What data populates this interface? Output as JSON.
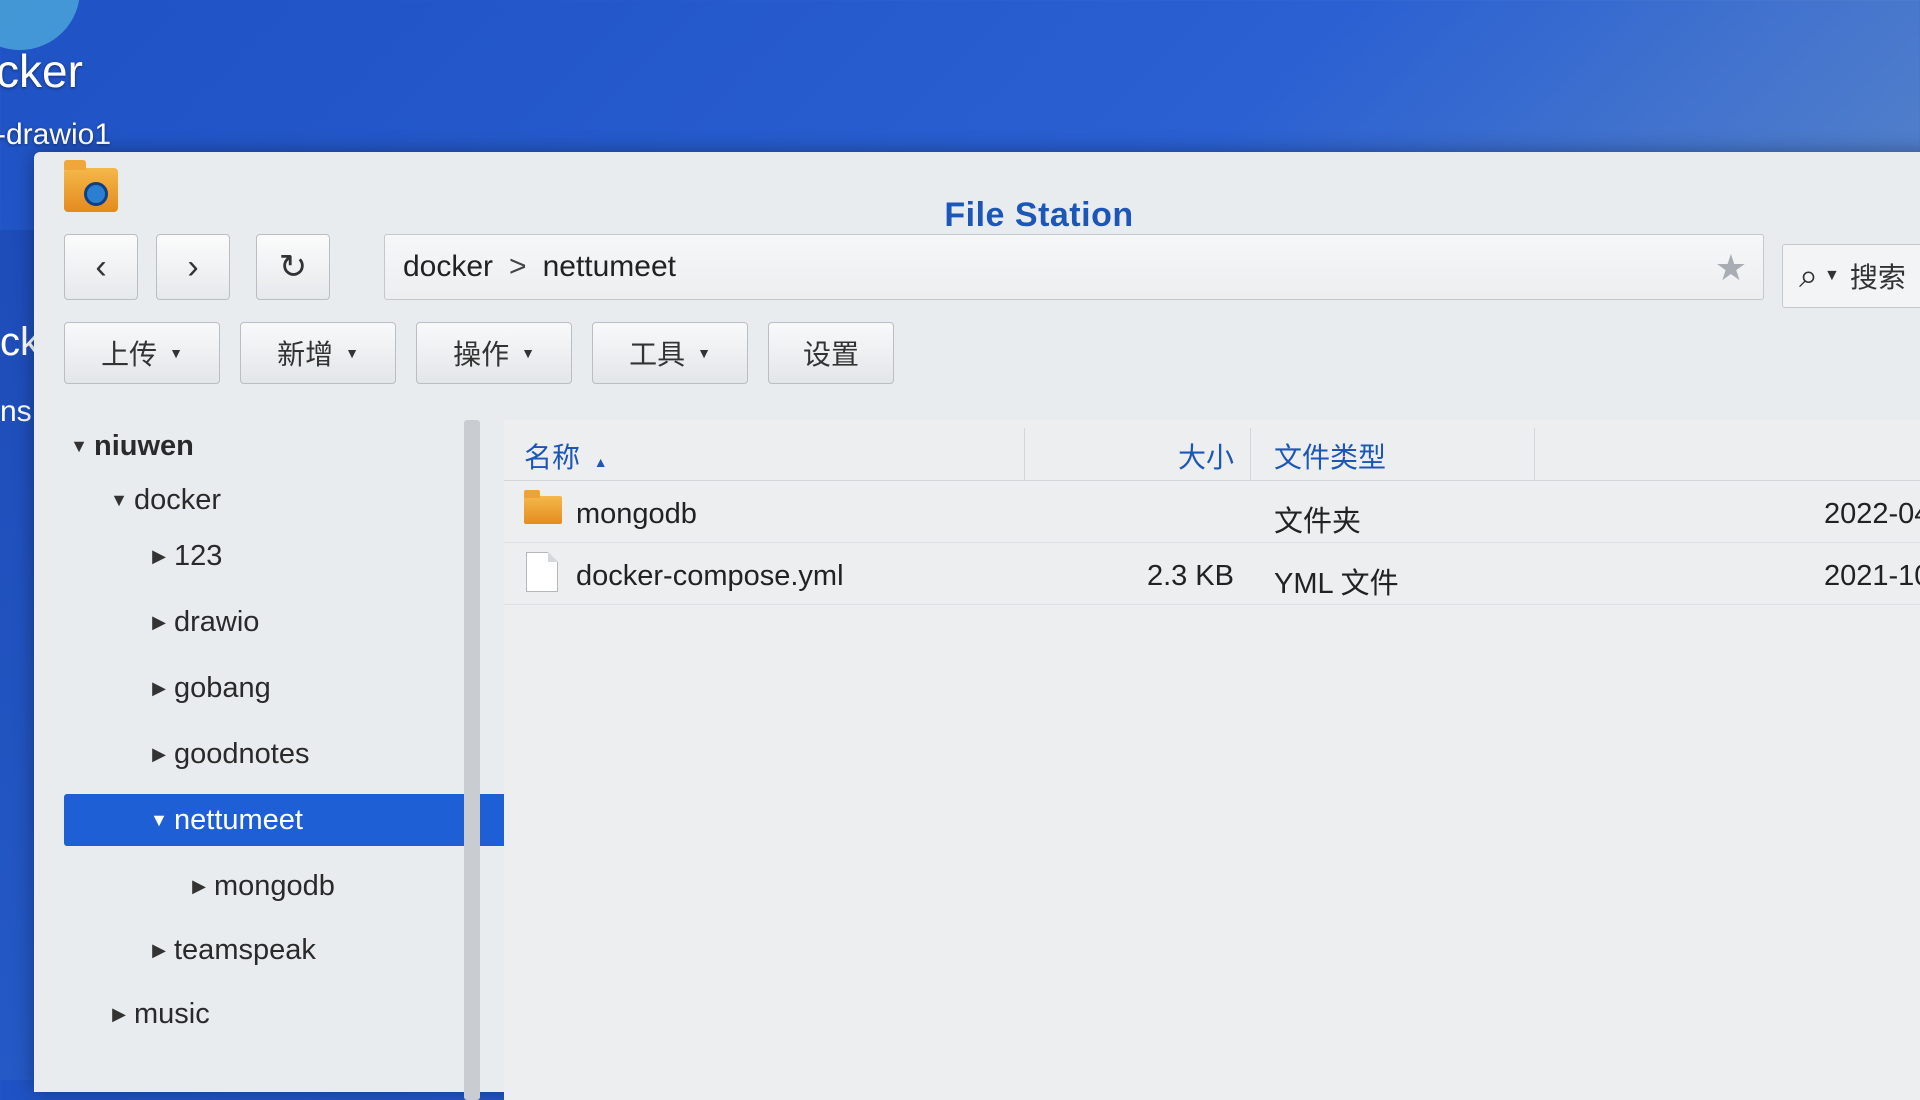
{
  "desktop": {
    "icon_label": "cker",
    "icon_sub_label": "-drawio1",
    "side_fragment_1": "ck",
    "side_fragment_2": "ns"
  },
  "window": {
    "title": "File Station"
  },
  "nav": {
    "back_icon": "chevron-left-icon",
    "forward_icon": "chevron-right-icon",
    "refresh_icon": "refresh-icon",
    "path": [
      "docker",
      "nettumeet"
    ],
    "path_separator": ">",
    "search_placeholder": "搜索"
  },
  "toolbar": {
    "upload": "上传",
    "create": "新增",
    "action": "操作",
    "tools": "工具",
    "settings": "设置"
  },
  "tree": [
    {
      "label": "niuwen",
      "level": 0,
      "expanded": true,
      "bold": true
    },
    {
      "label": "docker",
      "level": 1,
      "expanded": true
    },
    {
      "label": "123",
      "level": 2,
      "expanded": false
    },
    {
      "label": "drawio",
      "level": 2,
      "expanded": false
    },
    {
      "label": "gobang",
      "level": 2,
      "expanded": false
    },
    {
      "label": "goodnotes",
      "level": 2,
      "expanded": false
    },
    {
      "label": "nettumeet",
      "level": 2,
      "expanded": true,
      "selected": true
    },
    {
      "label": "mongodb",
      "level": 3,
      "expanded": false
    },
    {
      "label": "teamspeak",
      "level": 2,
      "expanded": false
    },
    {
      "label": "music",
      "level": 1,
      "expanded": false
    }
  ],
  "columns": {
    "name": "名称",
    "size": "大小",
    "type": "文件类型"
  },
  "files": [
    {
      "name": "mongodb",
      "size": "",
      "type": "文件夹",
      "modified": "2022-04",
      "kind": "folder"
    },
    {
      "name": "docker-compose.yml",
      "size": "2.3 KB",
      "type": "YML 文件",
      "modified": "2021-10",
      "kind": "file"
    }
  ],
  "colors": {
    "accent": "#1f5fd6",
    "header_text": "#1c57b8",
    "desktop": "#2a60d2"
  }
}
